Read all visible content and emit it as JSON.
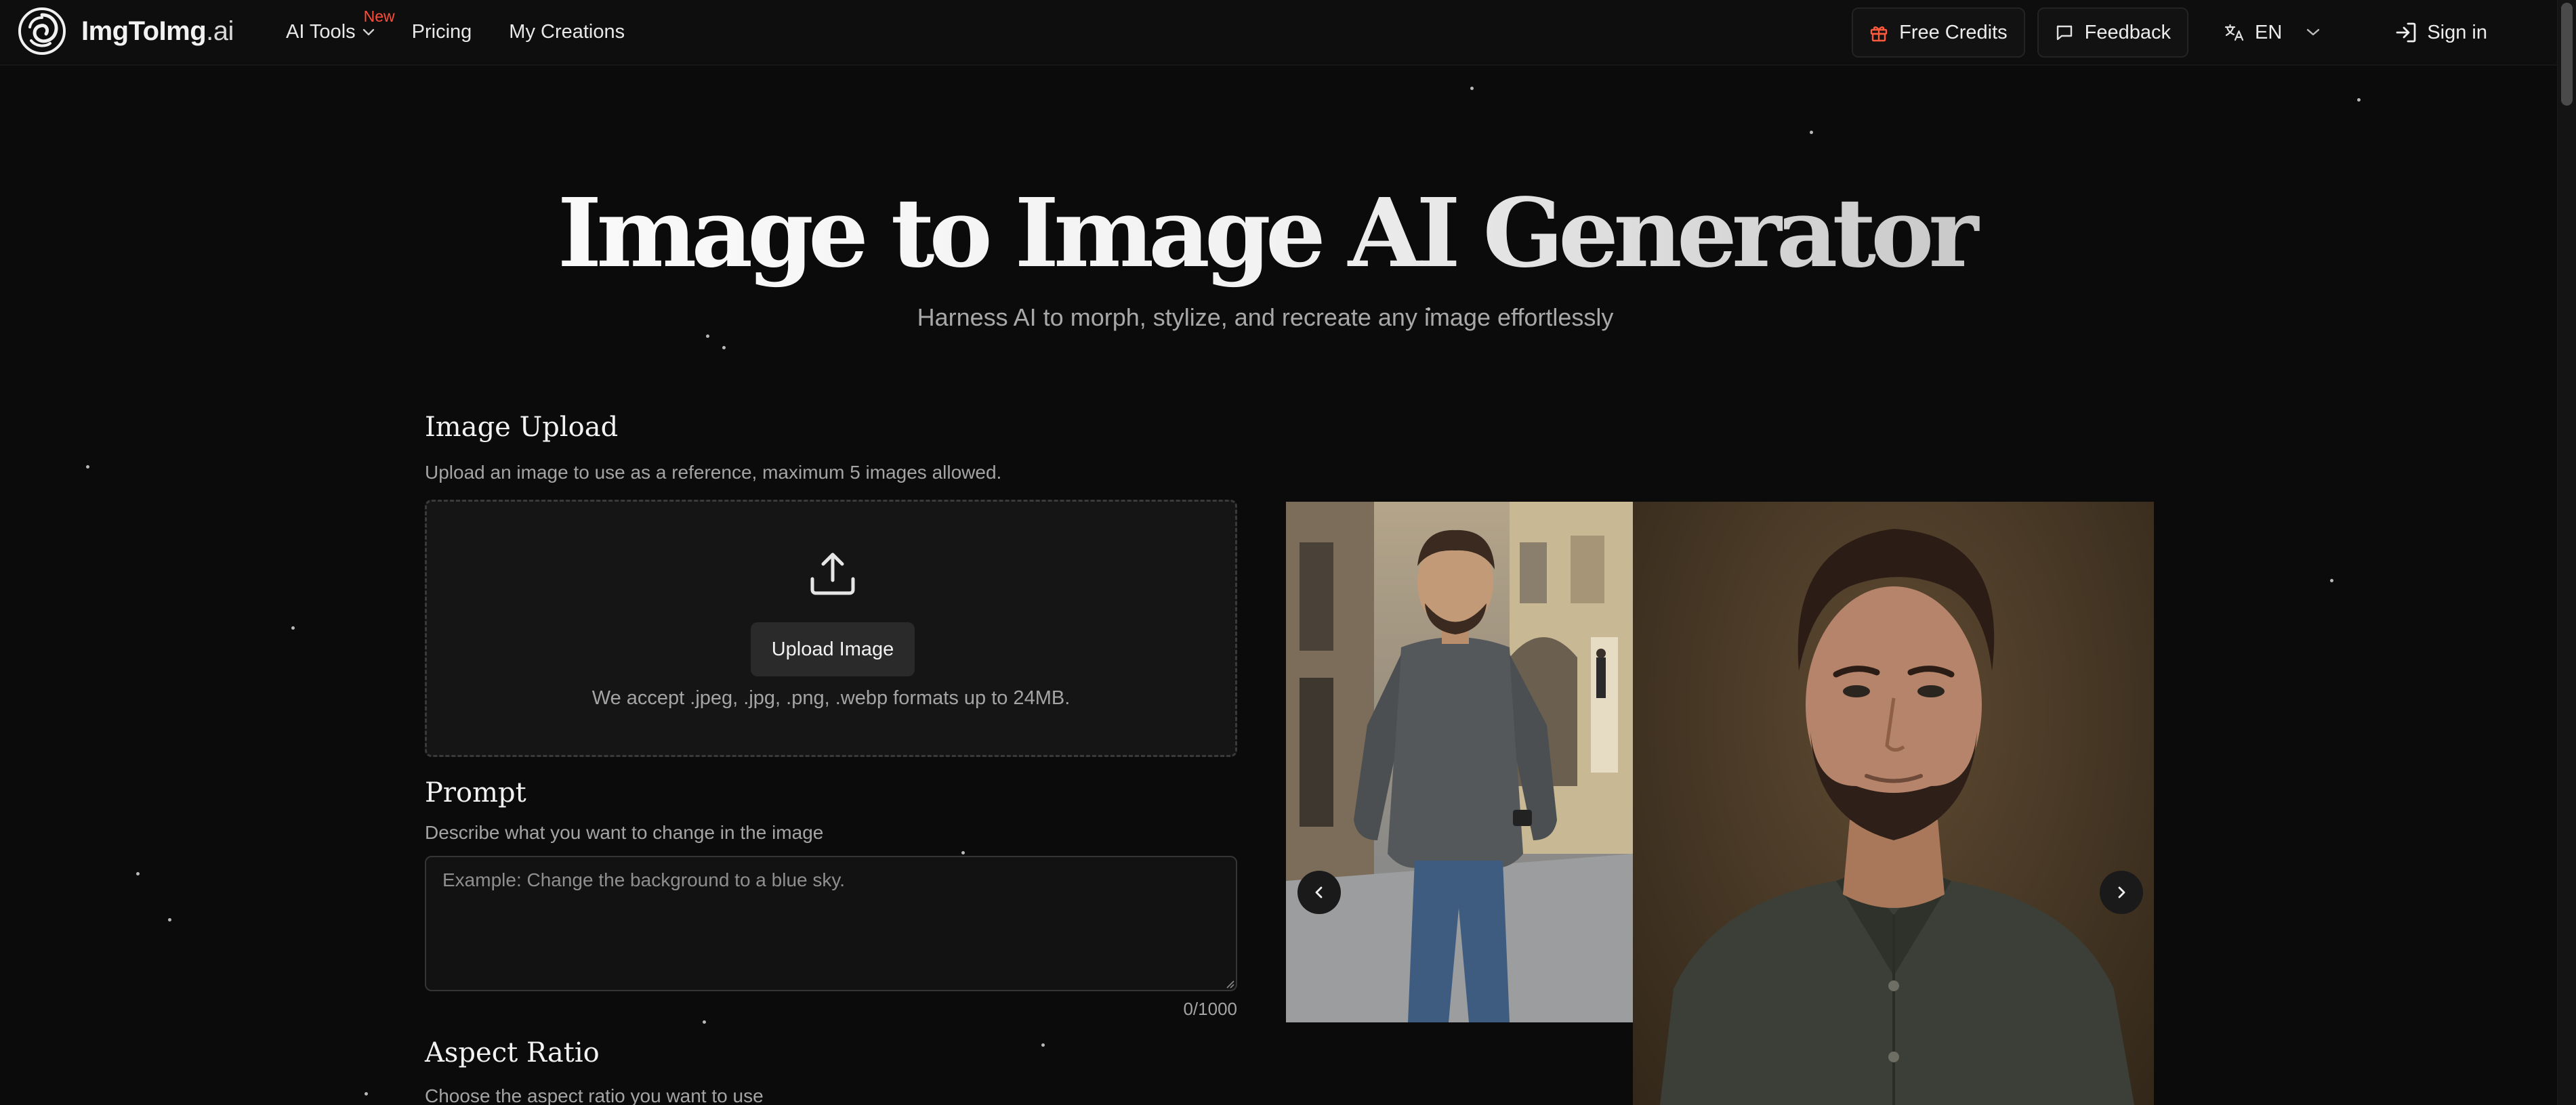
{
  "header": {
    "brand_name": "ImgToImg",
    "brand_tld": ".ai",
    "nav": {
      "ai_tools": "AI Tools",
      "new_badge": "New",
      "pricing": "Pricing",
      "my_creations": "My Creations"
    },
    "free_credits": "Free Credits",
    "feedback": "Feedback",
    "language": "EN",
    "sign_in": "Sign in"
  },
  "hero": {
    "title": "Image to Image AI Generator",
    "subtitle": "Harness AI to morph, stylize, and recreate any image effortlessly"
  },
  "upload": {
    "title": "Image Upload",
    "description": "Upload an image to use as a reference, maximum 5 images allowed.",
    "button_label": "Upload Image",
    "formats_note": "We accept .jpeg, .jpg, .png, .webp formats up to 24MB."
  },
  "prompt": {
    "title": "Prompt",
    "description": "Describe what you want to change in the image",
    "placeholder": "Example: Change the background to a blue sky.",
    "value": "",
    "char_count": "0/1000"
  },
  "aspect_ratio": {
    "title": "Aspect Ratio",
    "description": "Choose the aspect ratio you want to use"
  },
  "colors": {
    "background": "#0b0b0b",
    "new_badge": "#ff4d3a",
    "gift_icon": "#ff5a3c"
  }
}
